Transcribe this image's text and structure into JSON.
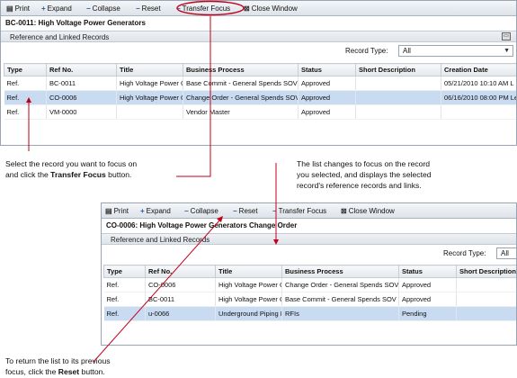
{
  "colors": {
    "accent": "#c0001a",
    "selected_row": "#c9dbf0",
    "toolbar": "#dde3ea"
  },
  "top": {
    "toolbar": {
      "print": "Print",
      "expand": "Expand",
      "collapse": "Collapse",
      "reset": "Reset",
      "transfer_focus": "Transfer Focus",
      "close_window": "Close Window"
    },
    "record_title": "BC-0011: High Voltage Power Generators",
    "section_title": "Reference and Linked Records",
    "record_type_label": "Record Type:",
    "record_type_value": "All",
    "columns": [
      "Type",
      "Ref No.",
      "Title",
      "Business Process",
      "Status",
      "Short Description",
      "Creation Date"
    ],
    "rows": [
      {
        "type": "Ref.",
        "ref": "BC-0011",
        "title": "High Voltage Power G",
        "process": "Base Commit - General Spends SOV",
        "status": "Approved",
        "desc": "",
        "date": "05/21/2010 10:10 AM L"
      },
      {
        "type": "Ref.",
        "ref": "CO-0006",
        "title": "High Voltage Power G",
        "process": "Change Order - General Spends SOV",
        "status": "Approved",
        "desc": "",
        "date": "06/16/2010 08:00 PM Le"
      },
      {
        "type": "Ref.",
        "ref": "VM-0000",
        "title": "",
        "process": "Vendor Master",
        "status": "Approved",
        "desc": "",
        "date": ""
      }
    ]
  },
  "bottom": {
    "toolbar": {
      "print": "Print",
      "expand": "Expand",
      "collapse": "Collapse",
      "reset": "Reset",
      "transfer_focus": "Transfer Focus",
      "close_window": "Close Window"
    },
    "record_title": "CO-0006: High Voltage Power Generators Change Order",
    "section_title": "Reference and Linked Records",
    "record_type_label": "Record Type:",
    "record_type_value": "All",
    "columns": [
      "Type",
      "Ref No.",
      "Title",
      "Business Process",
      "Status",
      "Short Description"
    ],
    "rows": [
      {
        "type": "Ref.",
        "ref": "CO-0006",
        "title": "High Voltage Power G",
        "process": "Change Order - General Spends SOV",
        "status": "Approved",
        "desc": ""
      },
      {
        "type": "Ref.",
        "ref": "BC-0011",
        "title": "High Voltage Power G",
        "process": "Base Commit - General Spends SOV",
        "status": "Approved",
        "desc": ""
      },
      {
        "type": "Ref.",
        "ref": "u-0066",
        "title": "Underground Piping M",
        "process": "RFIs",
        "status": "Pending",
        "desc": ""
      }
    ]
  },
  "annotations": {
    "select": {
      "line1": "Select the record you want to focus on",
      "line2_pre": "and click the ",
      "line2_bold": "Transfer Focus",
      "line2_post": " button."
    },
    "changes": {
      "line1": "The list changes to focus on the record",
      "line2": "you selected, and displays the selected",
      "line3": "record's reference records and links."
    },
    "reset": {
      "line1": "To return the list to its previous",
      "line2_pre": "focus, click the ",
      "line2_bold": "Reset",
      "line2_post": " button."
    }
  }
}
